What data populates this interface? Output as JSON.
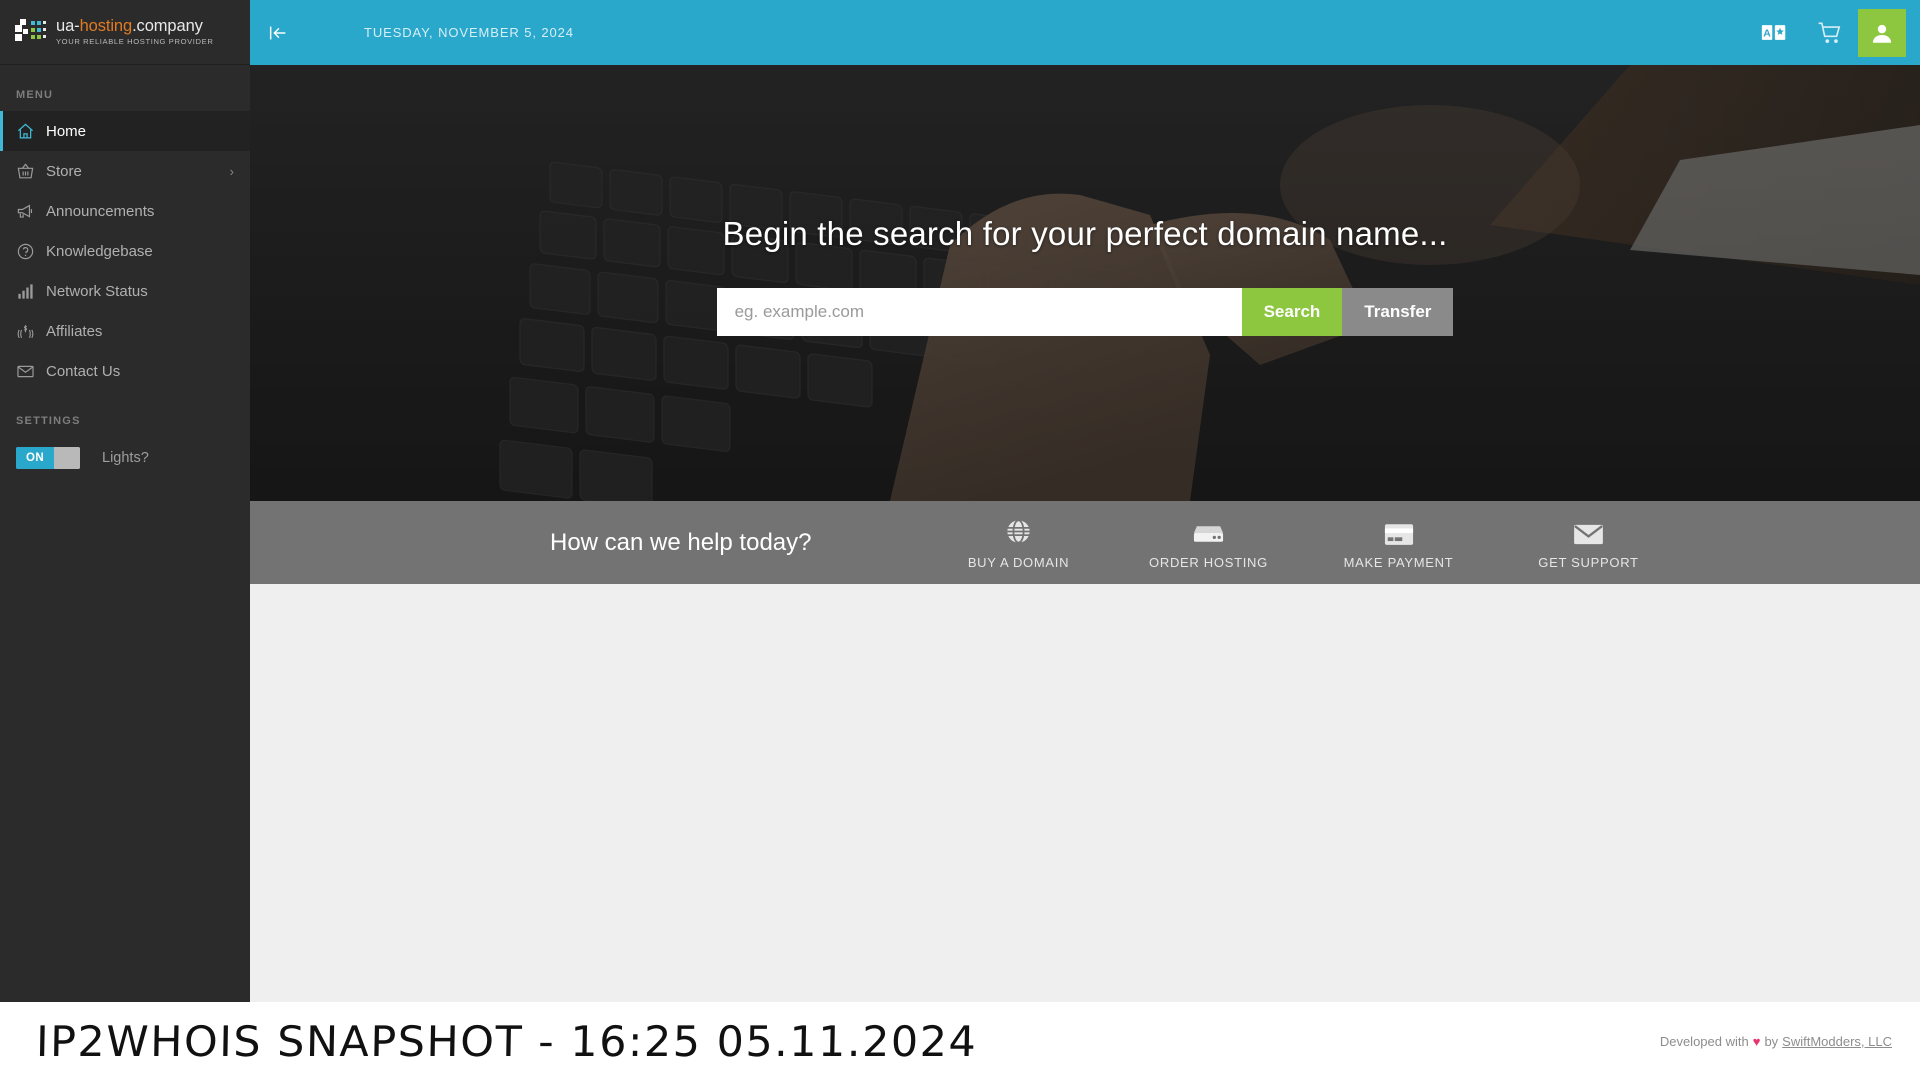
{
  "brand": {
    "name_prefix": "ua-",
    "name_highlight": "hosting",
    "name_suffix": ".company",
    "tagline": "YOUR RELIABLE HOSTING PROVIDER"
  },
  "sidebar": {
    "menu_heading": "MENU",
    "items": [
      {
        "label": "Home",
        "icon": "home-icon",
        "active": true,
        "chevron": ""
      },
      {
        "label": "Store",
        "icon": "basket-icon",
        "active": false,
        "chevron": "›"
      },
      {
        "label": "Announcements",
        "icon": "megaphone-icon",
        "active": false,
        "chevron": ""
      },
      {
        "label": "Knowledgebase",
        "icon": "question-icon",
        "active": false,
        "chevron": ""
      },
      {
        "label": "Network Status",
        "icon": "bar-chart-icon",
        "active": false,
        "chevron": ""
      },
      {
        "label": "Affiliates",
        "icon": "affiliate-icon",
        "active": false,
        "chevron": ""
      },
      {
        "label": "Contact Us",
        "icon": "envelope-icon",
        "active": false,
        "chevron": ""
      }
    ],
    "settings_heading": "SETTINGS",
    "lights_toggle_state": "ON",
    "lights_toggle_label": "Lights?"
  },
  "header": {
    "date": "TUESDAY, NOVEMBER 5, 2024",
    "collapse_icon": "collapse-left-icon",
    "language_icon": "language-icon",
    "cart_icon": "shopping-cart-icon",
    "avatar_icon": "user-avatar-icon"
  },
  "hero": {
    "title": "Begin the search for your perfect domain name...",
    "search_placeholder": "eg. example.com",
    "search_value": "",
    "search_button": "Search",
    "transfer_button": "Transfer"
  },
  "helpbar": {
    "title": "How can we help today?",
    "actions": [
      {
        "label": "BUY A DOMAIN",
        "icon": "globe-icon"
      },
      {
        "label": "ORDER HOSTING",
        "icon": "server-icon"
      },
      {
        "label": "MAKE PAYMENT",
        "icon": "credit-card-icon"
      },
      {
        "label": "GET SUPPORT",
        "icon": "envelope-icon"
      }
    ]
  },
  "banner": {
    "title": "IP2WHOIS SNAPSHOT - 16:25 05.11.2024",
    "credit_prefix": "Developed with",
    "credit_heart": "♥",
    "credit_by": "by",
    "credit_company": "SwiftModders, LLC"
  },
  "colors": {
    "header_blue": "#29a8cc",
    "accent_green": "#8dc63f",
    "sidebar_dark": "#2b2b2b",
    "helpbar_gray": "#737373",
    "content_gray": "#efefef",
    "brand_orange": "#e07b22",
    "heart_pink": "#e8356d"
  }
}
